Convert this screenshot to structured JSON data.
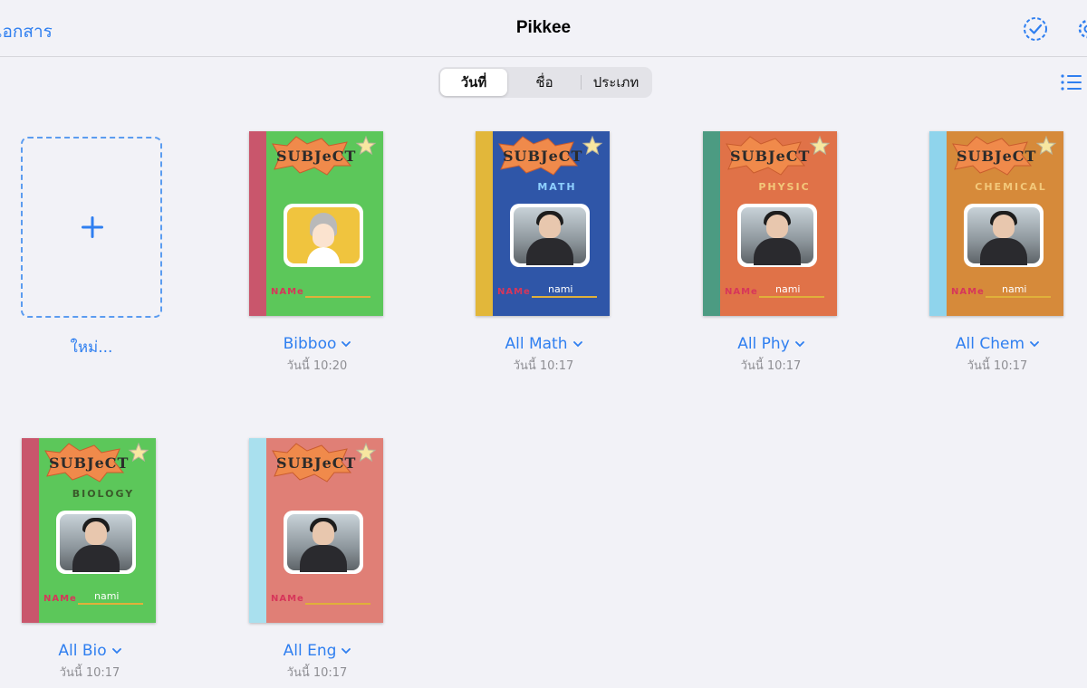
{
  "header": {
    "back_label": "เอกสาร",
    "title": "Pikkee"
  },
  "sort_tabs": [
    {
      "label": "วันที่",
      "active": true
    },
    {
      "label": "ชื่อ",
      "active": false
    },
    {
      "label": "ประเภท",
      "active": false
    }
  ],
  "new_doc": {
    "label": "ใหม่..."
  },
  "colors": {
    "accent": "#2f7ff0",
    "green_cover": "#5cc75a",
    "blue_cover": "#2f56a8",
    "orange_cover": "#e07248",
    "amber_cover": "#d68a3a",
    "pink_cover": "#e07f76"
  },
  "documents": [
    {
      "title": "Bibboo",
      "date": "วันนี้ 10:20",
      "cover": {
        "subject": "SUBJeCT",
        "subtitle": "",
        "name_label": "NAMe",
        "name_value": "",
        "bg": "#5cc75a",
        "spine": "#c9566c",
        "photo": "cartoon"
      }
    },
    {
      "title": "All Math",
      "date": "วันนี้ 10:17",
      "cover": {
        "subject": "SUBJeCT",
        "subtitle": "MATH",
        "name_label": "NAMe",
        "name_value": "nami",
        "bg": "#2f56a8",
        "spine": "#e2b73a",
        "photo": "person"
      }
    },
    {
      "title": "All Phy",
      "date": "วันนี้ 10:17",
      "cover": {
        "subject": "SUBJeCT",
        "subtitle": "PHYSIC",
        "name_label": "NAMe",
        "name_value": "nami",
        "bg": "#e07248",
        "spine": "#4c9b82",
        "photo": "person"
      }
    },
    {
      "title": "All Chem",
      "date": "วันนี้ 10:17",
      "cover": {
        "subject": "SUBJeCT",
        "subtitle": "CHEMICAL",
        "name_label": "NAMe",
        "name_value": "nami",
        "bg": "#d68a3a",
        "spine": "#8fd4ec",
        "photo": "person"
      }
    },
    {
      "title": "All Bio",
      "date": "วันนี้ 10:17",
      "cover": {
        "subject": "SUBJeCT",
        "subtitle": "BIOLOGY",
        "name_label": "NAMe",
        "name_value": "nami",
        "bg": "#5cc75a",
        "spine": "#c9566c",
        "photo": "person"
      }
    },
    {
      "title": "All Eng",
      "date": "วันนี้ 10:17",
      "cover": {
        "subject": "SUBJeCT",
        "subtitle": "",
        "name_label": "NAMe",
        "name_value": "",
        "bg": "#e07f76",
        "spine": "#a9e0ee",
        "photo": "person"
      }
    }
  ]
}
